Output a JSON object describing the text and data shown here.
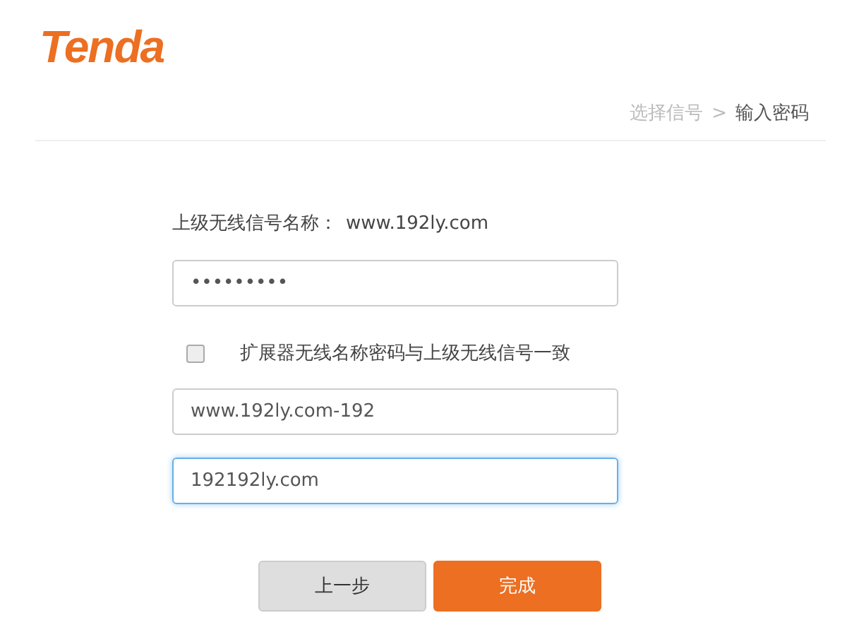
{
  "logo": "Tenda",
  "breadcrumb": [
    {
      "label": "选择信号",
      "selected": false
    },
    {
      "label": "输入密码",
      "selected": true
    }
  ],
  "breadcrumb_separator": ">",
  "upstream": {
    "label": "上级无线信号名称：",
    "value": "www.192ly.com"
  },
  "fields": [
    {
      "kind": "password",
      "value": "•••••••••",
      "focused": false
    },
    {
      "kind": "checkbox",
      "label": "扩展器无线名称密码与上级无线信号一致",
      "checked": false
    },
    {
      "kind": "text",
      "value": "www.192ly.com-192",
      "focused": false
    },
    {
      "kind": "text",
      "value": "192192ly.com",
      "focused": true
    }
  ],
  "buttons": [
    {
      "label": "上一步",
      "kind": "secondary"
    },
    {
      "label": "完成",
      "kind": "primary"
    }
  ]
}
